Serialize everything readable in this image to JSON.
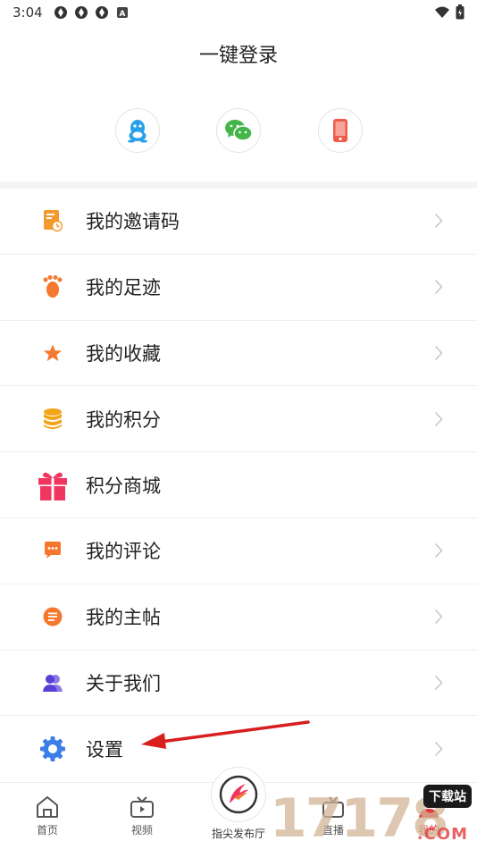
{
  "status_bar": {
    "time": "3:04",
    "icons": [
      "app-notification-icon",
      "app-notification-icon",
      "app-notification-icon",
      "letter-a-icon"
    ],
    "right_icons": [
      "wifi-icon",
      "battery-icon"
    ]
  },
  "header": {
    "title": "一键登录"
  },
  "login_options": [
    {
      "id": "qq",
      "icon": "qq-icon",
      "color": "#2aa0e8"
    },
    {
      "id": "wechat",
      "icon": "wechat-icon",
      "color": "#44b549"
    },
    {
      "id": "phone",
      "icon": "phone-icon",
      "color": "#f05a4a"
    }
  ],
  "menu": {
    "items": [
      {
        "label": "我的邀请码",
        "icon": "invite-code-icon",
        "color": "#f39a2f",
        "chevron": true
      },
      {
        "label": "我的足迹",
        "icon": "footprint-icon",
        "color": "#f6782e",
        "chevron": true
      },
      {
        "label": "我的收藏",
        "icon": "star-icon",
        "color": "#f6782e",
        "chevron": true
      },
      {
        "label": "我的积分",
        "icon": "coins-icon",
        "color": "#f3a51a",
        "chevron": true
      },
      {
        "label": "积分商城",
        "icon": "gift-icon",
        "color": "#f0355f",
        "chevron": false
      },
      {
        "label": "我的评论",
        "icon": "comment-icon",
        "color": "#f6782e",
        "chevron": true
      },
      {
        "label": "我的主帖",
        "icon": "post-icon",
        "color": "#f6782e",
        "chevron": true
      },
      {
        "label": "关于我们",
        "icon": "users-icon",
        "color": "#5a3fd6",
        "chevron": true
      },
      {
        "label": "设置",
        "icon": "gear-icon",
        "color": "#3a7ee6",
        "chevron": true
      }
    ]
  },
  "bottom_nav": {
    "items": [
      {
        "label": "首页",
        "icon": "home-icon"
      },
      {
        "label": "视频",
        "icon": "tv-icon"
      },
      {
        "label": "指尖发布厅",
        "icon": "brand-logo-icon"
      },
      {
        "label": "直播",
        "icon": "live-icon"
      },
      {
        "label": "我的",
        "icon": "profile-icon",
        "active": true
      }
    ]
  },
  "watermark": {
    "digits": "17178",
    "badge": "下载站",
    "suffix": ".COM"
  },
  "colors": {
    "annotation_arrow": "#d81e1e",
    "chevron": "#c8c8c8",
    "divider": "#efefef"
  }
}
